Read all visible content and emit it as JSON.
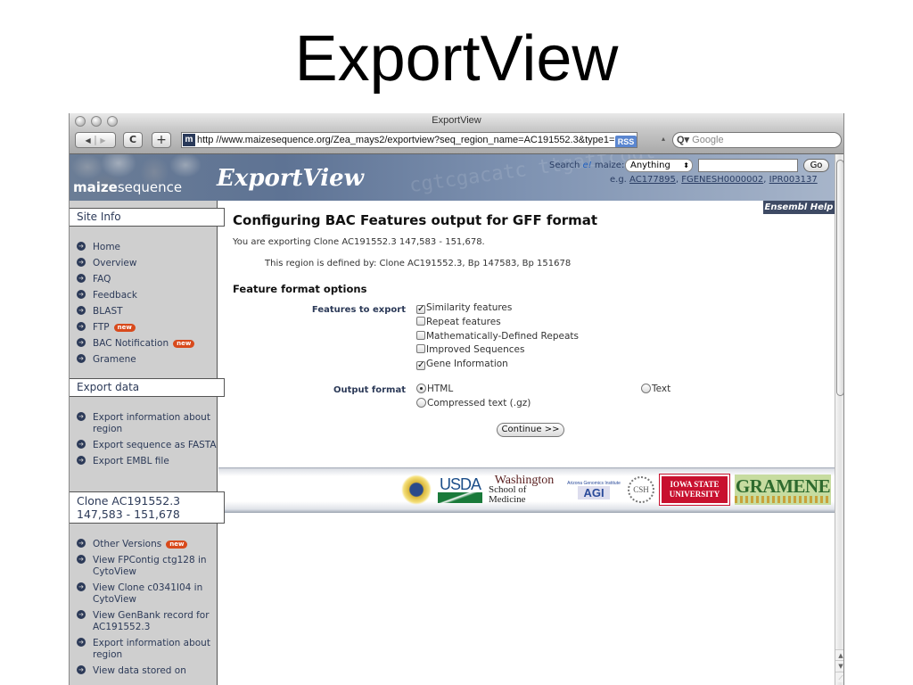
{
  "slide_title": "ExportView",
  "window": {
    "title": "ExportView",
    "url": "http //www.maizesequence.org/Zea_mays2/exportview?seq_region_name=AC191552.3&type1=",
    "favicon_letter": "m",
    "rss_label": "RSS",
    "search_placeholder": "Google",
    "back_icon": "◀",
    "forward_icon": "▶",
    "reload_icon": "C",
    "add_icon": "+",
    "search_icon": "Q▾"
  },
  "banner": {
    "logo_bold": "maize",
    "logo_rest": "sequence",
    "heading": "ExportView",
    "seq_text": "cgtcgacatc ttgattcggt",
    "search_label_pre": "Search ",
    "search_label_e": "e!",
    "search_label_post": " maize:",
    "search_select_value": "Anything",
    "search_value": "",
    "go_label": "Go",
    "eg_prefix": "e.g. ",
    "examples": [
      "AC177895",
      "FGENESH0000002",
      "IPR003137"
    ]
  },
  "sidebar": {
    "site_info": {
      "title": "Site Info",
      "items": [
        {
          "label": "Home"
        },
        {
          "label": "Overview"
        },
        {
          "label": "FAQ"
        },
        {
          "label": "Feedback"
        },
        {
          "label": "BLAST"
        },
        {
          "label": "FTP",
          "badge": "new"
        },
        {
          "label": "BAC Notification",
          "badge": "new"
        },
        {
          "label": "Gramene"
        }
      ]
    },
    "export_data": {
      "title": "Export data",
      "items": [
        {
          "label": "Export information about region"
        },
        {
          "label": "Export sequence as FASTA"
        },
        {
          "label": "Export EMBL file"
        }
      ]
    },
    "clone": {
      "title_line1": "Clone AC191552.3",
      "title_line2": "147,583 - 151,678",
      "items": [
        {
          "label": "Other Versions",
          "badge": "new"
        },
        {
          "label": "View FPContig ctg128 in CytoView"
        },
        {
          "label": "View Clone c0341I04 in CytoView"
        },
        {
          "label": "View GenBank record for AC191552.3"
        },
        {
          "label": "Export information about region"
        },
        {
          "label": "View data stored on"
        }
      ]
    }
  },
  "main": {
    "help_label": "Ensembl Help",
    "title": "Configuring BAC Features output for GFF format",
    "exporting_text": "You are exporting Clone AC191552.3 147,583 - 151,678.",
    "region_text": "This region is defined by: Clone AC191552.3, Bp 147583, Bp 151678",
    "options_heading": "Feature format options",
    "features_label": "Features to export",
    "features": [
      {
        "label": "Similarity features",
        "checked": true,
        "check_glyph": "✓"
      },
      {
        "label": "Repeat features",
        "checked": false,
        "check_glyph": ""
      },
      {
        "label": "Mathematically-Defined Repeats",
        "checked": false,
        "check_glyph": ""
      },
      {
        "label": "Improved Sequences",
        "checked": false,
        "check_glyph": ""
      },
      {
        "label": "Gene Information",
        "checked": true,
        "check_glyph": "✓"
      }
    ],
    "output_label": "Output format",
    "output_options": [
      {
        "label": "HTML",
        "selected": true
      },
      {
        "label": "Text",
        "selected": false
      },
      {
        "label": "Compressed text (.gz)",
        "selected": false
      }
    ],
    "continue_label": "Continue >>"
  },
  "sponsors": {
    "usda": "USDA",
    "washington_line1": "Washington",
    "washington_line2": "School of Medicine",
    "agi_small": "Arizona Genomics Institute",
    "agi": "AGI",
    "csh": "CSH",
    "isu_line1": "IOWA STATE",
    "isu_line2": "UNIVERSITY",
    "gramene": "GRAMENE"
  },
  "scrollbar": {
    "up_icon": "▲",
    "down_icon": "▼"
  }
}
